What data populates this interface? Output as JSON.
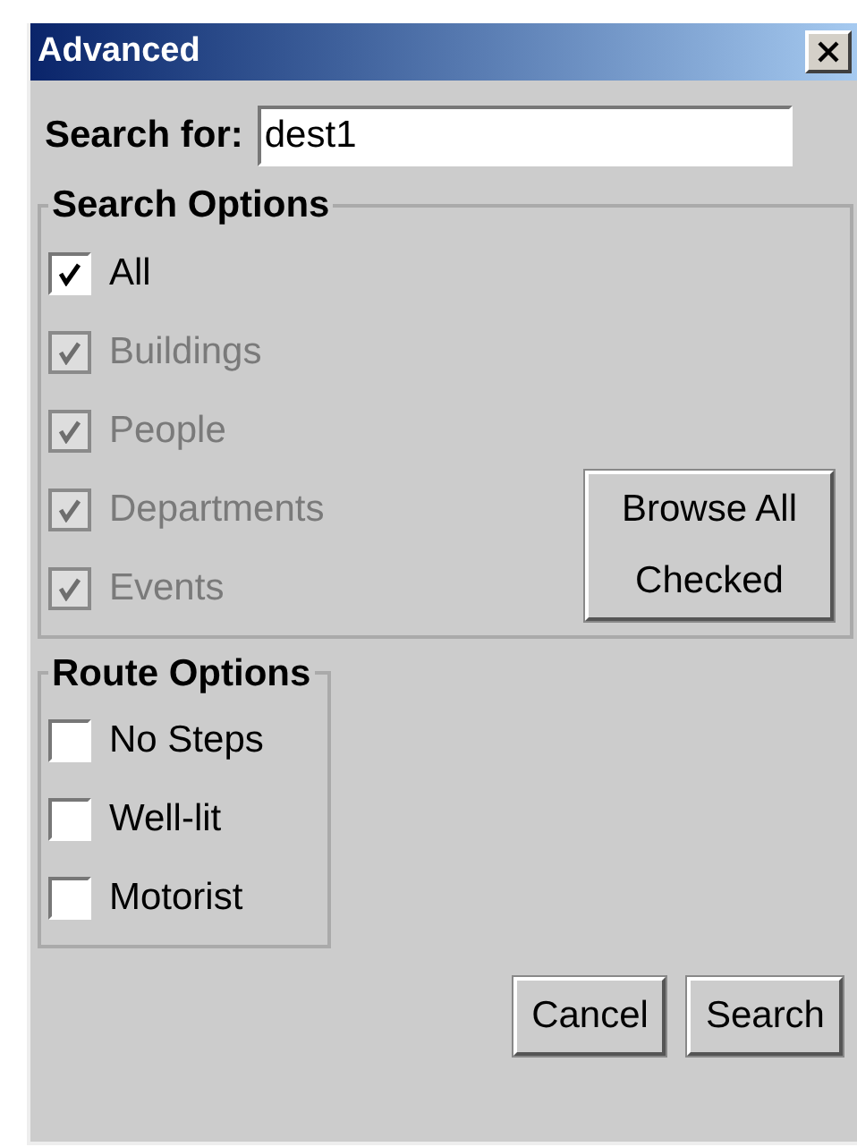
{
  "window": {
    "title": "Advanced"
  },
  "search": {
    "label": "Search for:",
    "value": "dest1"
  },
  "search_options": {
    "title": "Search Options",
    "items": [
      {
        "label": "All",
        "checked": true,
        "disabled": false
      },
      {
        "label": "Buildings",
        "checked": true,
        "disabled": true
      },
      {
        "label": "People",
        "checked": true,
        "disabled": true
      },
      {
        "label": "Departments",
        "checked": true,
        "disabled": true
      },
      {
        "label": "Events",
        "checked": true,
        "disabled": true
      }
    ],
    "button": "Browse All Checked"
  },
  "route_options": {
    "title": "Route Options",
    "items": [
      {
        "label": "No Steps",
        "checked": false,
        "disabled": false
      },
      {
        "label": "Well-lit",
        "checked": false,
        "disabled": false
      },
      {
        "label": "Motorist",
        "checked": false,
        "disabled": false
      }
    ]
  },
  "buttons": [
    "Cancel",
    "Search"
  ]
}
